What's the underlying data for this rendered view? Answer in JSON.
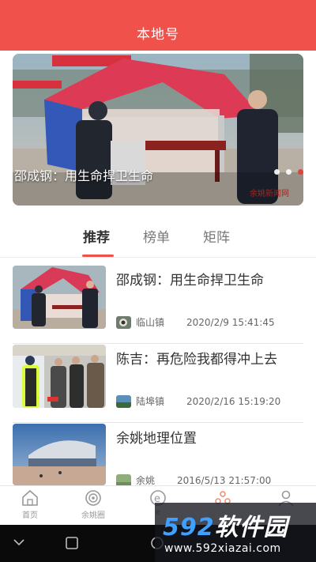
{
  "header": {
    "title": "本地号"
  },
  "banner": {
    "caption": "邵成钢：用生命捍卫生命",
    "dots": 3,
    "active_dot": 2,
    "image_text": "余姚新闻网"
  },
  "tabs": [
    {
      "label": "推荐",
      "active": true
    },
    {
      "label": "榜单",
      "active": false
    },
    {
      "label": "矩阵",
      "active": false
    }
  ],
  "articles": [
    {
      "title": "邵成钢：用生命捍卫生命",
      "source": "临山镇",
      "time": "2020/2/9 15:41:45"
    },
    {
      "title": "陈吉：再危险我都得冲上去",
      "source": "陆埠镇",
      "time": "2020/2/16 15:19:20"
    },
    {
      "title": "余姚地理位置",
      "source": "余姚",
      "time": "2016/5/13 21:57:00"
    }
  ],
  "bottom_nav": [
    {
      "label": "首页",
      "icon": "home-icon"
    },
    {
      "label": "余姚圈",
      "icon": "circle-icon"
    },
    {
      "label": "e",
      "icon": "e-icon"
    },
    {
      "label": "",
      "icon": "local-icon"
    },
    {
      "label": "",
      "icon": "user-icon"
    }
  ],
  "watermark": {
    "logo_num": "592",
    "logo_text": "软件园",
    "url": "www.592xiazai.com"
  },
  "colors": {
    "brand": "#f0514b",
    "text": "#333333",
    "meta": "#666666"
  }
}
